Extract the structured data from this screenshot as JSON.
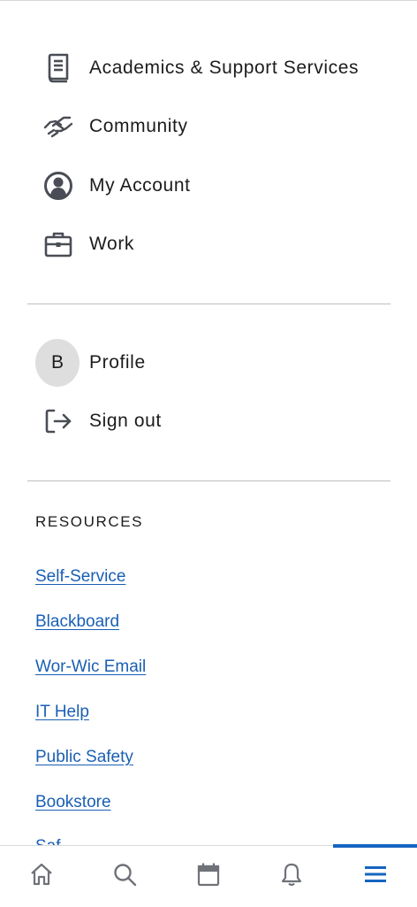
{
  "menu": {
    "items": [
      {
        "label": "Academics & Support Services",
        "icon": "book-icon"
      },
      {
        "label": "Community",
        "icon": "handshake-icon"
      },
      {
        "label": "My Account",
        "icon": "user-circle-icon"
      },
      {
        "label": "Work",
        "icon": "briefcase-icon"
      }
    ]
  },
  "account": {
    "avatar_initial": "B",
    "profile_label": "Profile",
    "sign_out_label": "Sign out"
  },
  "resources": {
    "heading": "RESOURCES",
    "links": [
      "Self-Service",
      "Blackboard",
      "Wor-Wic Email",
      "IT Help",
      "Public Safety",
      "Bookstore",
      "Saf"
    ]
  },
  "bottom_nav": {
    "items": [
      "home-icon",
      "search-icon",
      "calendar-icon",
      "bell-icon",
      "menu-icon"
    ],
    "active": "menu-icon",
    "active_color": "#1565c0",
    "icon_color": "#6f7278"
  },
  "colors": {
    "link": "#1a5fb4",
    "text": "#1c1c1c",
    "icon": "#4a4d55"
  }
}
